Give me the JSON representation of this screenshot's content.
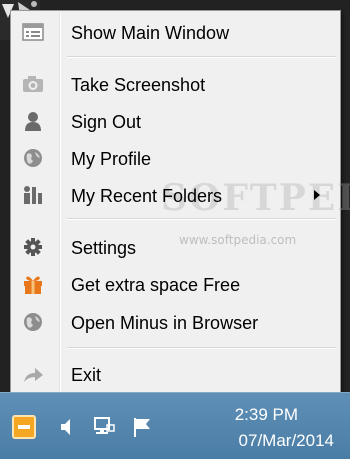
{
  "menu": {
    "items": [
      {
        "label": "Show Main Window",
        "icon": "window-list-icon"
      },
      {
        "label": "Take Screenshot",
        "icon": "camera-icon"
      },
      {
        "label": "Sign Out",
        "icon": "user-icon"
      },
      {
        "label": "My Profile",
        "icon": "globe-icon"
      },
      {
        "label": "My Recent Folders",
        "icon": "folders-icon",
        "has_submenu": true
      },
      {
        "label": "Settings",
        "icon": "gear-icon"
      },
      {
        "label": "Get extra space Free",
        "icon": "gift-icon"
      },
      {
        "label": "Open Minus in Browser",
        "icon": "globe-icon"
      },
      {
        "label": "Exit",
        "icon": "exit-arrow-icon"
      }
    ]
  },
  "watermark": {
    "text": "SOFTPEDIA",
    "url": "www.softpedia.com"
  },
  "taskbar": {
    "time": "2:39 PM",
    "date": "07/Mar/2014"
  },
  "colors": {
    "menu_bg": "#f0f0f0",
    "taskbar": "#5a8ab1",
    "gift": "#e8761a",
    "tray_app": "#f5a623"
  }
}
